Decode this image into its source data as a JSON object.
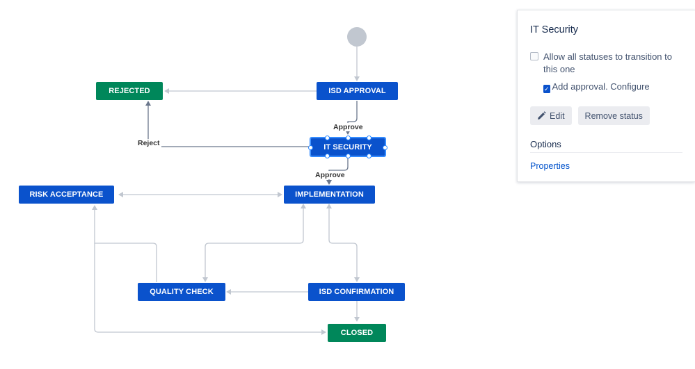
{
  "diagram": {
    "nodes": {
      "rejected": "REJECTED",
      "isd_approval": "ISD APPROVAL",
      "it_security": "IT SECURITY",
      "risk_acceptance": "RISK ACCEPTANCE",
      "implementation": "IMPLEMENTATION",
      "quality_check": "QUALITY CHECK",
      "isd_confirmation": "ISD CONFIRMATION",
      "closed": "CLOSED"
    },
    "transitions": {
      "approve_1": "Approve",
      "approve_2": "Approve",
      "reject": "Reject"
    },
    "colors": {
      "status_blue": "#0a52cc",
      "status_green": "#00875a",
      "edge": "#c1c7d0"
    }
  },
  "panel": {
    "title": "IT Security",
    "allow_all_label": "Allow all statuses to transition to this one",
    "allow_all_checked": false,
    "add_approval_label": "Add approval. Configure",
    "add_approval_checked": true,
    "edit_button": "Edit",
    "remove_button": "Remove status",
    "options_heading": "Options",
    "properties_link": "Properties"
  }
}
